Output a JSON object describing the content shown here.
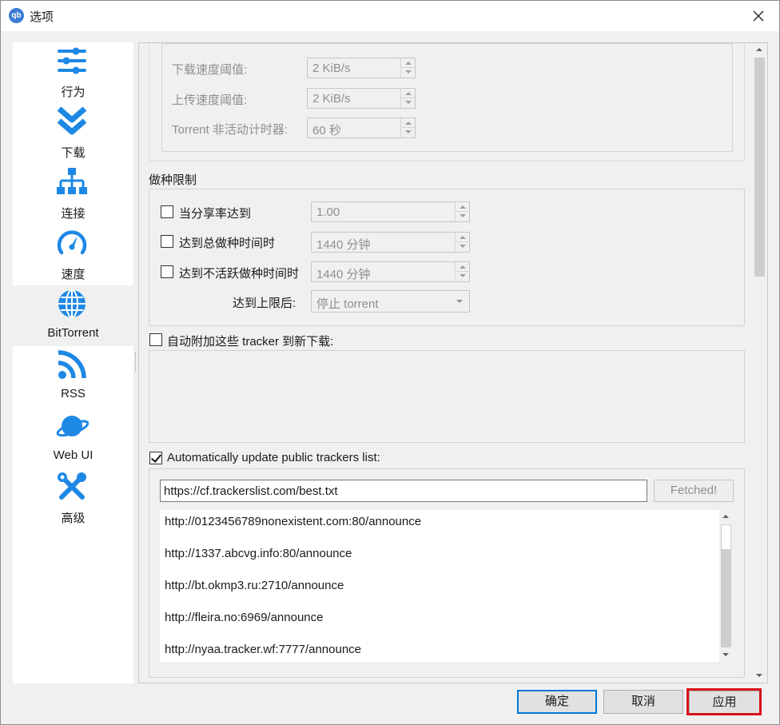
{
  "window": {
    "title": "选项",
    "app_icon_text": "qb"
  },
  "sidebar": {
    "items": [
      {
        "label": "行为",
        "icon": "sliders-icon"
      },
      {
        "label": "下载",
        "icon": "double-chevron-down-icon"
      },
      {
        "label": "连接",
        "icon": "network-icon"
      },
      {
        "label": "速度",
        "icon": "speedometer-icon"
      },
      {
        "label": "BitTorrent",
        "icon": "globe-icon",
        "selected": true
      },
      {
        "label": "RSS",
        "icon": "rss-icon"
      },
      {
        "label": "Web UI",
        "icon": "planet-icon"
      },
      {
        "label": "高级",
        "icon": "tools-icon"
      }
    ]
  },
  "queue": {
    "download_threshold_label": "下载速度阈值:",
    "download_threshold_value": "2 KiB/s",
    "upload_threshold_label": "上传速度阈值:",
    "upload_threshold_value": "2 KiB/s",
    "inactive_timer_label": "Torrent 非活动计时器:",
    "inactive_timer_value": "60 秒"
  },
  "seeding": {
    "title": "做种限制",
    "ratio_label": "当分享率达到",
    "ratio_value": "1.00",
    "total_time_label": "达到总做种时间时",
    "total_time_value": "1440 分钟",
    "inactive_time_label": "达到不活跃做种时间时",
    "inactive_time_value": "1440 分钟",
    "action_label": "达到上限后:",
    "action_value": "停止 torrent"
  },
  "add_trackers": {
    "label": "自动附加这些 tracker 到新下载:",
    "checked": false
  },
  "public_trackers": {
    "label": "Automatically update public trackers list:",
    "checked": true,
    "url": "https://cf.trackerslist.com/best.txt",
    "fetch_button": "Fetched!",
    "list": [
      "http://0123456789nonexistent.com:80/announce",
      "http://1337.abcvg.info:80/announce",
      "http://bt.okmp3.ru:2710/announce",
      "http://fleira.no:6969/announce",
      "http://nyaa.tracker.wf:7777/announce"
    ]
  },
  "buttons": {
    "ok": "确定",
    "cancel": "取消",
    "apply": "应用"
  },
  "colors": {
    "accent": "#1e88e5",
    "highlight": "#d8121c"
  }
}
